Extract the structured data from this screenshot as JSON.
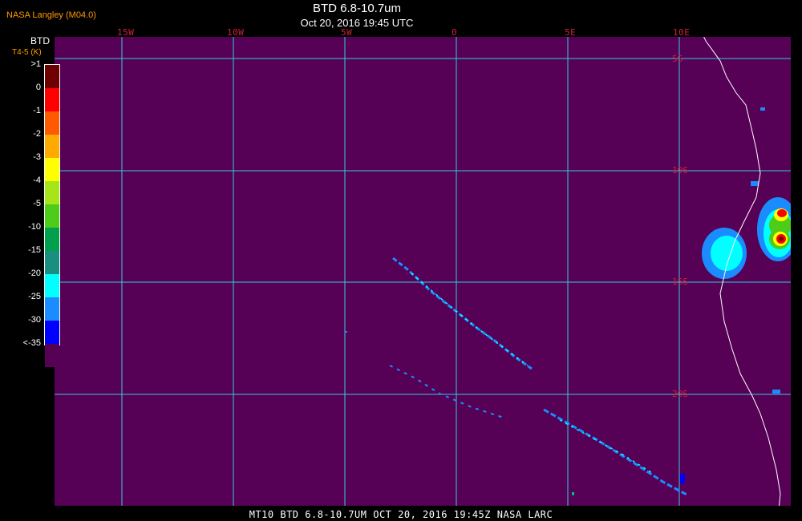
{
  "header": {
    "brand": "NASA Langley (M04.0)",
    "title": "BTD 6.8-10.7um",
    "datetime": "Oct 20, 2016 19:45 UTC"
  },
  "map": {
    "background_color": "#560056",
    "grid_color": "#33ccdd",
    "coast_color": "#ffffff",
    "longitude_labels": [
      "15W",
      "10W",
      "5W",
      "0",
      "5E",
      "10E"
    ],
    "latitude_labels": [
      "5S",
      "10S",
      "15S",
      "20S"
    ]
  },
  "legend": {
    "title": "BTD",
    "subtitle": "T4-5 (K)",
    "bins": [
      {
        "label": ">1",
        "color": "#6e0000"
      },
      {
        "label": "0",
        "color": "#ff0000"
      },
      {
        "label": "-1",
        "color": "#ff5a00"
      },
      {
        "label": "-2",
        "color": "#ffaa00"
      },
      {
        "label": "-3",
        "color": "#ffff00"
      },
      {
        "label": "-4",
        "color": "#a6e619"
      },
      {
        "label": "-5",
        "color": "#4dcc1a"
      },
      {
        "label": "-10",
        "color": "#00a04c"
      },
      {
        "label": "-15",
        "color": "#1a8f7f"
      },
      {
        "label": "-20",
        "color": "#00ffff"
      },
      {
        "label": "-25",
        "color": "#1a8cff"
      },
      {
        "label": "-30",
        "color": "#0000ff"
      },
      {
        "label": "<-35",
        "color": "#560056"
      }
    ]
  },
  "footer": {
    "text": "MT10  BTD 6.8-10.7UM   OCT 20, 2016 19:45Z   NASA LARC"
  }
}
